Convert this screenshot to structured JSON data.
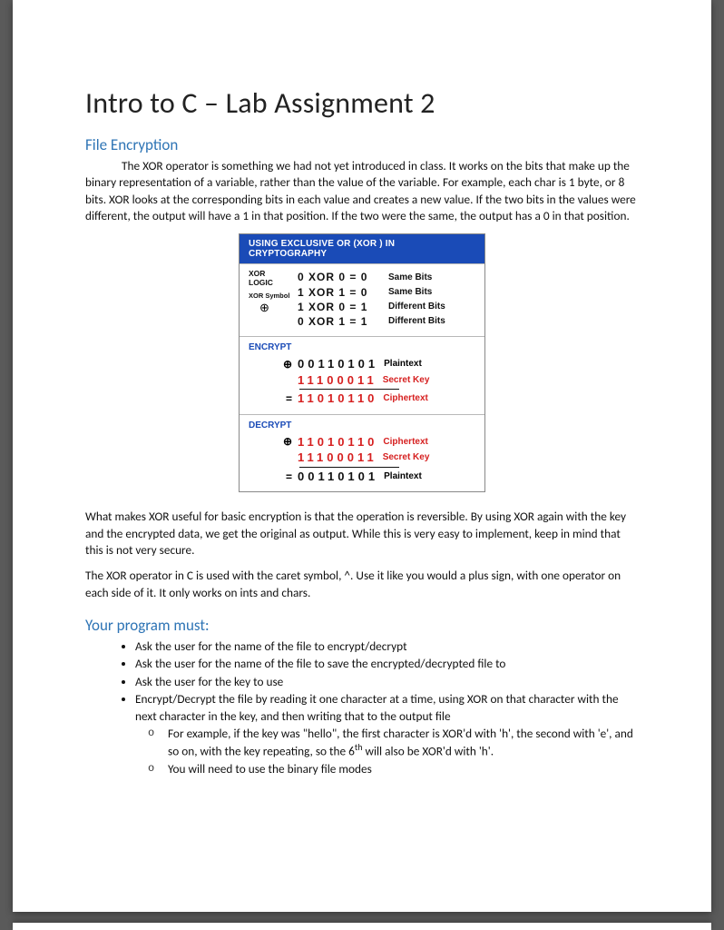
{
  "title": "Intro to C – Lab Assignment 2",
  "section1": "File Encryption",
  "para1": "The XOR operator is something we had not yet introduced in class. It works on the bits that make up the binary representation of a variable, rather than the value of the variable. For example, each char is 1 byte, or 8 bits. XOR looks at the corresponding bits in each value and creates a new value. If the two bits in the values were different, the output will have a 1 in that position. If the two were the same, the output has a 0 in that position.",
  "figure": {
    "header": "USING EXCLUSIVE OR (XOR ) IN CRYPTOGRAPHY",
    "logic_label_top": "XOR",
    "logic_label_bot": "LOGIC",
    "symbol_label": "XOR Symbol",
    "symbol_glyph": "⊕",
    "logic_rows": [
      {
        "eq": "0 XOR 0 = 0",
        "label": "Same Bits"
      },
      {
        "eq": "1 XOR 1 = 0",
        "label": "Same Bits"
      },
      {
        "eq": "1 XOR 0 = 1",
        "label": "Different Bits"
      },
      {
        "eq": "0 XOR 1 = 1",
        "label": "Different Bits"
      }
    ],
    "encrypt": {
      "title": "ENCRYPT",
      "op1": "⊕",
      "op2": "=",
      "rows": [
        {
          "bits": "00110101",
          "label": "Plaintext",
          "red": false
        },
        {
          "bits": "11100011",
          "label": "Secret Key",
          "red": true
        },
        {
          "bits": "11010110",
          "label": "Ciphertext",
          "red": true
        }
      ]
    },
    "decrypt": {
      "title": "DECRYPT",
      "op1": "⊕",
      "op2": "=",
      "rows": [
        {
          "bits": "11010110",
          "label": "Ciphertext",
          "red": true
        },
        {
          "bits": "11100011",
          "label": "Secret Key",
          "red": true
        },
        {
          "bits": "00110101",
          "label": "Plaintext",
          "red": false
        }
      ]
    }
  },
  "para2": "What makes XOR useful for basic encryption is that the operation is reversible. By using XOR again with the key and the encrypted data, we get the original as output. While this is very easy to implement, keep in mind that this is not very secure.",
  "para3": "The XOR operator in C is used with the caret symbol, ^. Use it like you would a plus sign, with one operator on each side of it. It only works on ints and chars.",
  "section2": "Your program must:",
  "requirements": [
    "Ask the user for the name of the file to encrypt/decrypt",
    "Ask the user for the name of the file to save the encrypted/decrypted file to",
    "Ask the user for the key to use"
  ],
  "requirement4": "Encrypt/Decrypt the file by reading it one character at a time, using XOR on that character with the next character in the key, and then writing that to the output file",
  "sub1_a": "For example, if the key was \"hello\", the first character is XOR'd with 'h', the second with 'e', and so on, with the key repeating, so the 6",
  "sub1_sup": "th",
  "sub1_b": " will also be XOR'd with 'h'.",
  "sub2": "You will need to use the binary file modes"
}
